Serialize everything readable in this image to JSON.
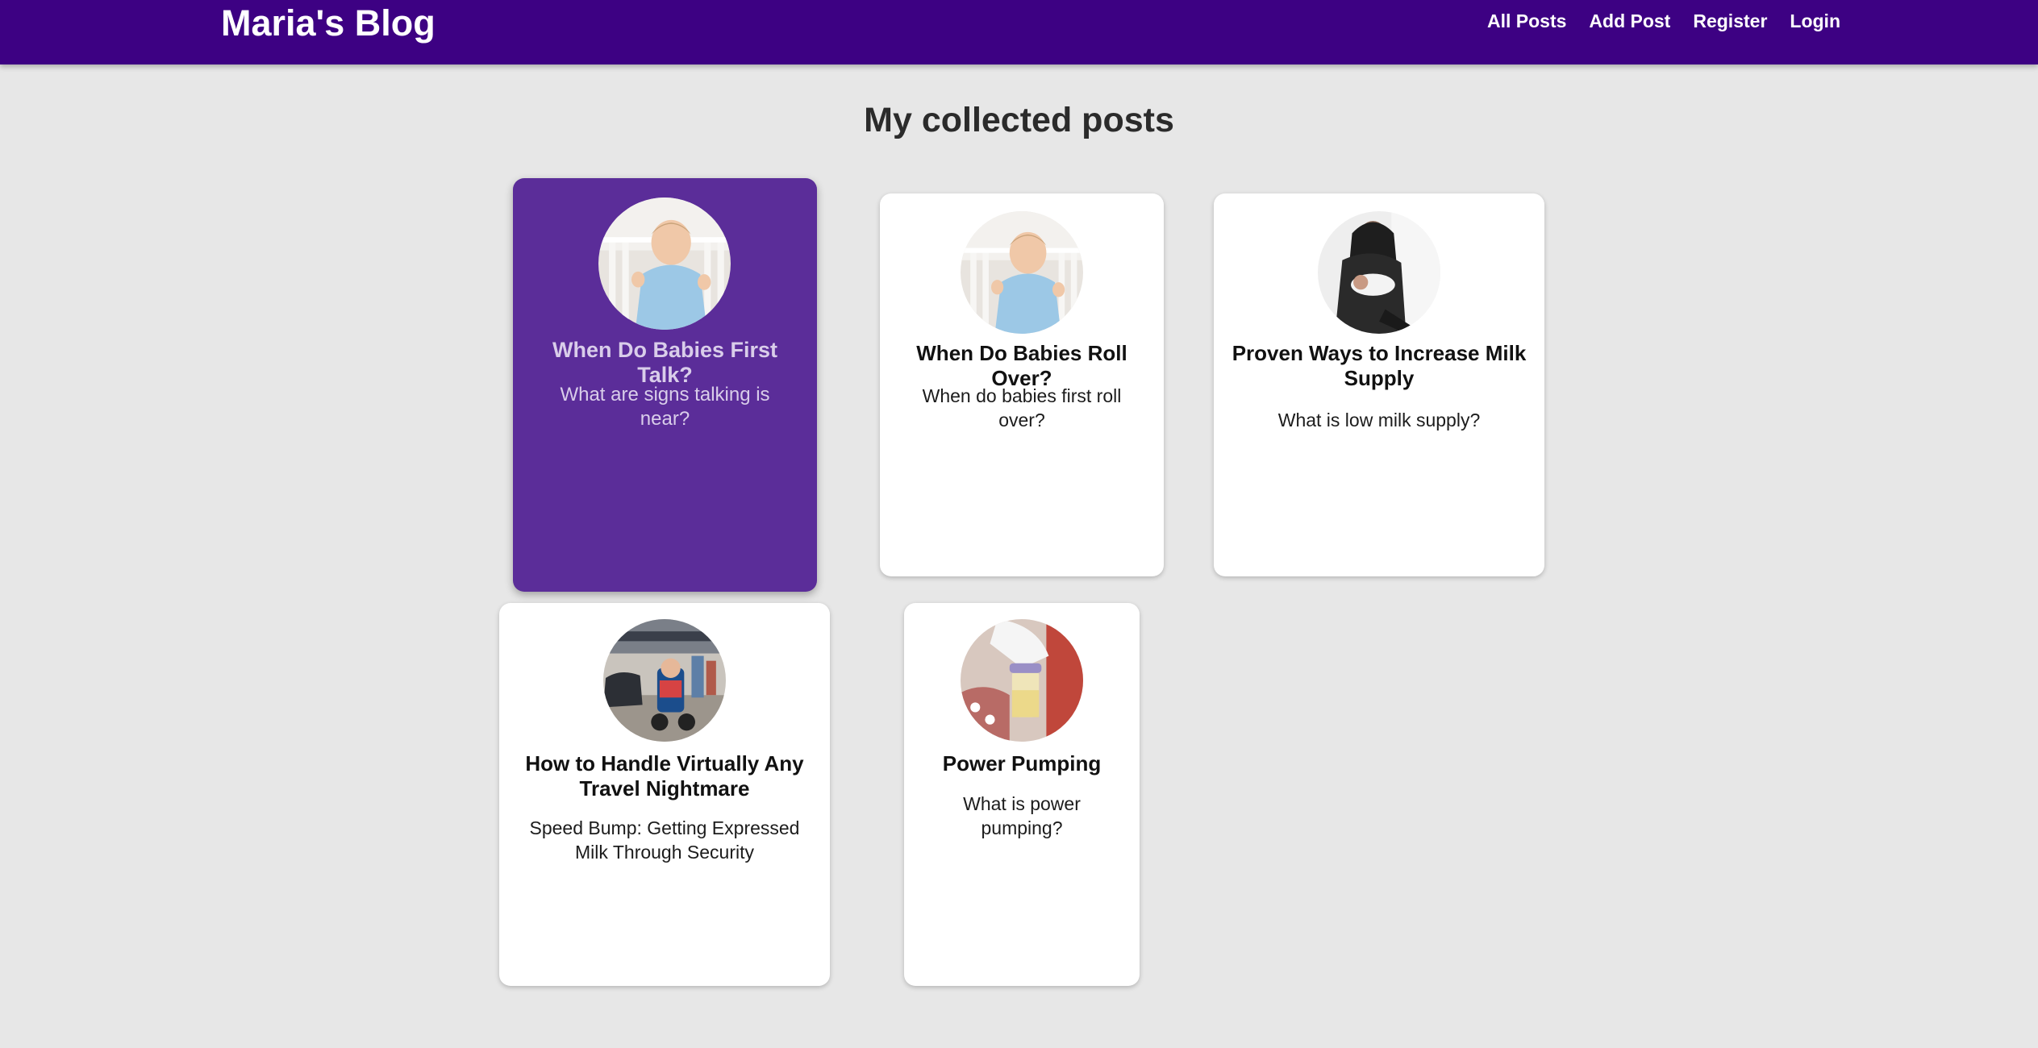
{
  "header": {
    "brand": "Maria's Blog",
    "nav": {
      "all_posts": "All Posts",
      "add_post": "Add Post",
      "register": "Register",
      "login": "Login"
    }
  },
  "main": {
    "heading": "My collected posts",
    "posts": [
      {
        "title": "When Do Babies First Talk?",
        "description": "What are signs talking is near?",
        "image": "baby-in-crib-photo",
        "state": "hovered"
      },
      {
        "title": "When Do Babies Roll Over?",
        "description": "When do babies first roll over?",
        "image": "baby-in-crib-photo"
      },
      {
        "title": "Proven Ways to Increase Milk Supply",
        "description": "What is low milk supply?",
        "image": "mother-holding-newborn-photo"
      },
      {
        "title": "How to Handle Virtually Any Travel Nightmare",
        "description": "Speed Bump: Getting Expressed Milk Through Security",
        "image": "airport-stroller-photo"
      },
      {
        "title": "Power Pumping",
        "description": "What is power pumping?",
        "image": "breast-pump-photo"
      }
    ]
  },
  "colors": {
    "navbar": "#3d0183",
    "active_card": "#5b2d99",
    "page_background": "#e7e7e7",
    "card_background": "#ffffff"
  }
}
